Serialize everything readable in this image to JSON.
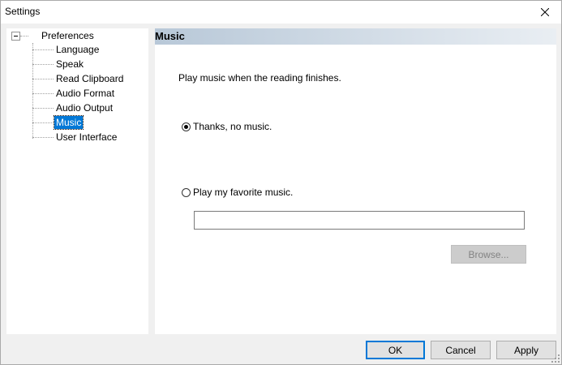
{
  "window": {
    "title": "Settings",
    "close_icon": "close-icon"
  },
  "tree": {
    "root_label": "Preferences",
    "items": [
      {
        "label": "Language",
        "selected": false
      },
      {
        "label": "Speak",
        "selected": false
      },
      {
        "label": "Read Clipboard",
        "selected": false
      },
      {
        "label": "Audio Format",
        "selected": false
      },
      {
        "label": "Audio Output",
        "selected": false
      },
      {
        "label": "Music",
        "selected": true
      },
      {
        "label": "User Interface",
        "selected": false
      }
    ]
  },
  "content": {
    "header": "Music",
    "prompt": "Play music when the reading finishes.",
    "option_no_music": {
      "label": "Thanks, no music.",
      "checked": true
    },
    "option_favorite": {
      "label": "Play my favorite music.",
      "checked": false
    },
    "music_path_value": "",
    "browse_label": "Browse...",
    "watermark": "SOFTPEDIA"
  },
  "buttons": {
    "ok": "OK",
    "cancel": "Cancel",
    "apply": "Apply"
  },
  "colors": {
    "selection": "#0078d7",
    "header_gradient_start": "#b8c8d8",
    "header_gradient_end": "#e9eef3"
  }
}
